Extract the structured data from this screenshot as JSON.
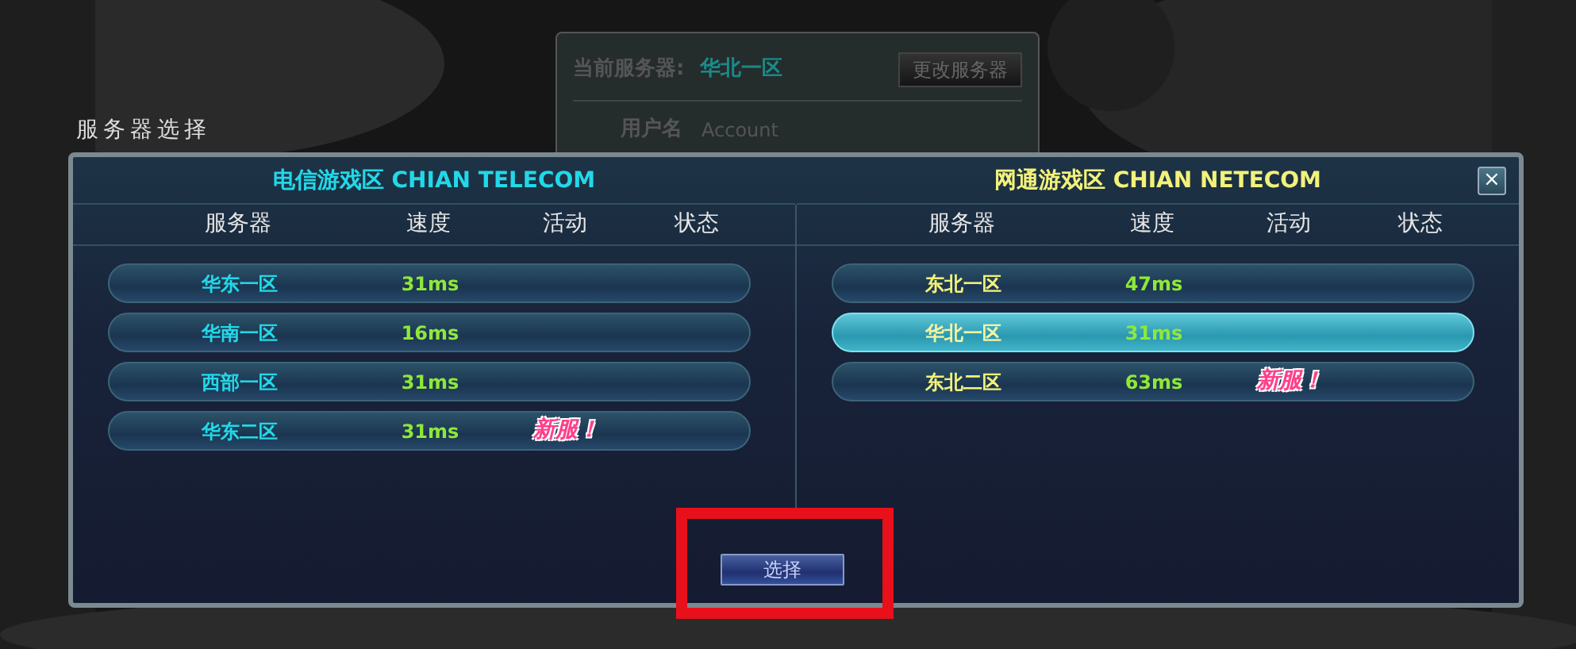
{
  "login_panel": {
    "current_server_label": "当前服务器:",
    "current_server": "华北一区",
    "change_button": "更改服务器",
    "username_label": "用户名",
    "username_placeholder": "Account"
  },
  "heading": "服务器选择",
  "zones": [
    {
      "title": "电信游戏区 CHIAN TELECOM",
      "color": "#22d8e8",
      "columns": [
        "服务器",
        "速度",
        "活动",
        "状态"
      ],
      "servers": [
        {
          "name": "华东一区",
          "speed": "31ms",
          "selected": false
        },
        {
          "name": "华南一区",
          "speed": "16ms",
          "selected": false
        },
        {
          "name": "西部一区",
          "speed": "31ms",
          "selected": false
        },
        {
          "name": "华东二区",
          "speed": "31ms",
          "activity": "新服！",
          "selected": false
        }
      ]
    },
    {
      "title": "网通游戏区 CHIAN NETECOM",
      "color": "#f2f27a",
      "columns": [
        "服务器",
        "速度",
        "活动",
        "状态"
      ],
      "servers": [
        {
          "name": "东北一区",
          "speed": "47ms",
          "selected": false
        },
        {
          "name": "华北一区",
          "speed": "31ms",
          "selected": true
        },
        {
          "name": "东北二区",
          "speed": "63ms",
          "activity": "新服！",
          "selected": false
        }
      ]
    }
  ],
  "close_button": "×",
  "select_button": "选择"
}
